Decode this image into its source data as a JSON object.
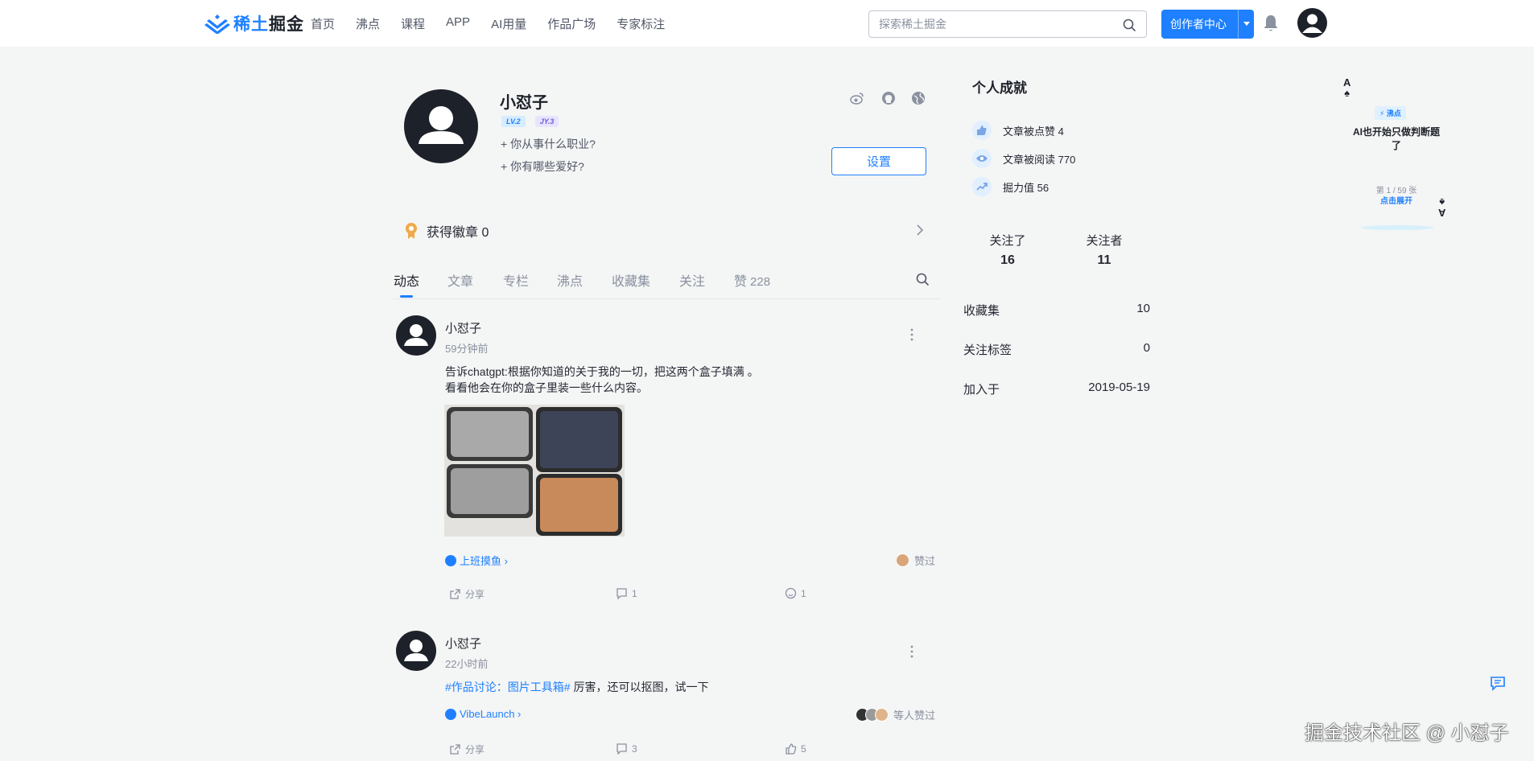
{
  "brand": {
    "name_blue": "稀土",
    "name_dark": "掘金"
  },
  "nav": [
    "首页",
    "沸点",
    "课程",
    "APP",
    "AI用量",
    "作品广场",
    "专家标注"
  ],
  "search": {
    "placeholder": "探索稀土掘金"
  },
  "header": {
    "creator_label": "创作者中心"
  },
  "profile": {
    "name": "小怼子",
    "level_badge": "JY.3",
    "level_badge_a": "LV.2",
    "occupation_prompt": "+ 你从事什么职业?",
    "hobby_prompt": "+ 你有哪些爱好?",
    "settings_label": "设置",
    "badges_text": "获得徽章 0"
  },
  "tabs": [
    {
      "label": "动态"
    },
    {
      "label": "文章"
    },
    {
      "label": "专栏"
    },
    {
      "label": "沸点"
    },
    {
      "label": "收藏集"
    },
    {
      "label": "关注"
    },
    {
      "label": "赞",
      "count": "228"
    }
  ],
  "feed": [
    {
      "name": "小怼子",
      "time": "59分钟前",
      "line1": "告诉chatgpt:根据你知道的关于我的一切，把这两个盒子填满 。",
      "line2": "看看他会在你的盒子里装一些什么内容。",
      "circle": "上班摸鱼 ›",
      "liked": "赞过",
      "share": "分享",
      "comments": "1",
      "likes": "1"
    },
    {
      "name": "小怼子",
      "time": "22小时前",
      "tag": "#作品讨论：图片工具箱#",
      "text": " 厉害，还可以抠图，试一下",
      "circle": "VibeLaunch ›",
      "liked": "等人赞过",
      "share": "分享",
      "comments": "3",
      "likes": "5"
    }
  ],
  "achievements": {
    "title": "个人成就",
    "rows": [
      "文章被点赞 4",
      "文章被阅读 770",
      "掘力值 56"
    ]
  },
  "follow": {
    "following_label": "关注了",
    "following_value": "16",
    "followers_label": "关注者",
    "followers_value": "11"
  },
  "stats": [
    {
      "label": "收藏集",
      "value": "10"
    },
    {
      "label": "关注标签",
      "value": "0"
    },
    {
      "label": "加入于",
      "value": "2019-05-19"
    }
  ],
  "promo": {
    "corner": "A",
    "pill": "⚡ 沸点",
    "title_line1": "AI也开始只做判断题",
    "title_line2": "了",
    "page": "第 1 / 59 张",
    "open": "点击展开"
  },
  "watermark": "掘金技术社区 @ 小怼子",
  "colors": {
    "brand": "#1e80ff",
    "background": "#f4f5f5",
    "text": "#252933",
    "muted": "#8a919f"
  }
}
